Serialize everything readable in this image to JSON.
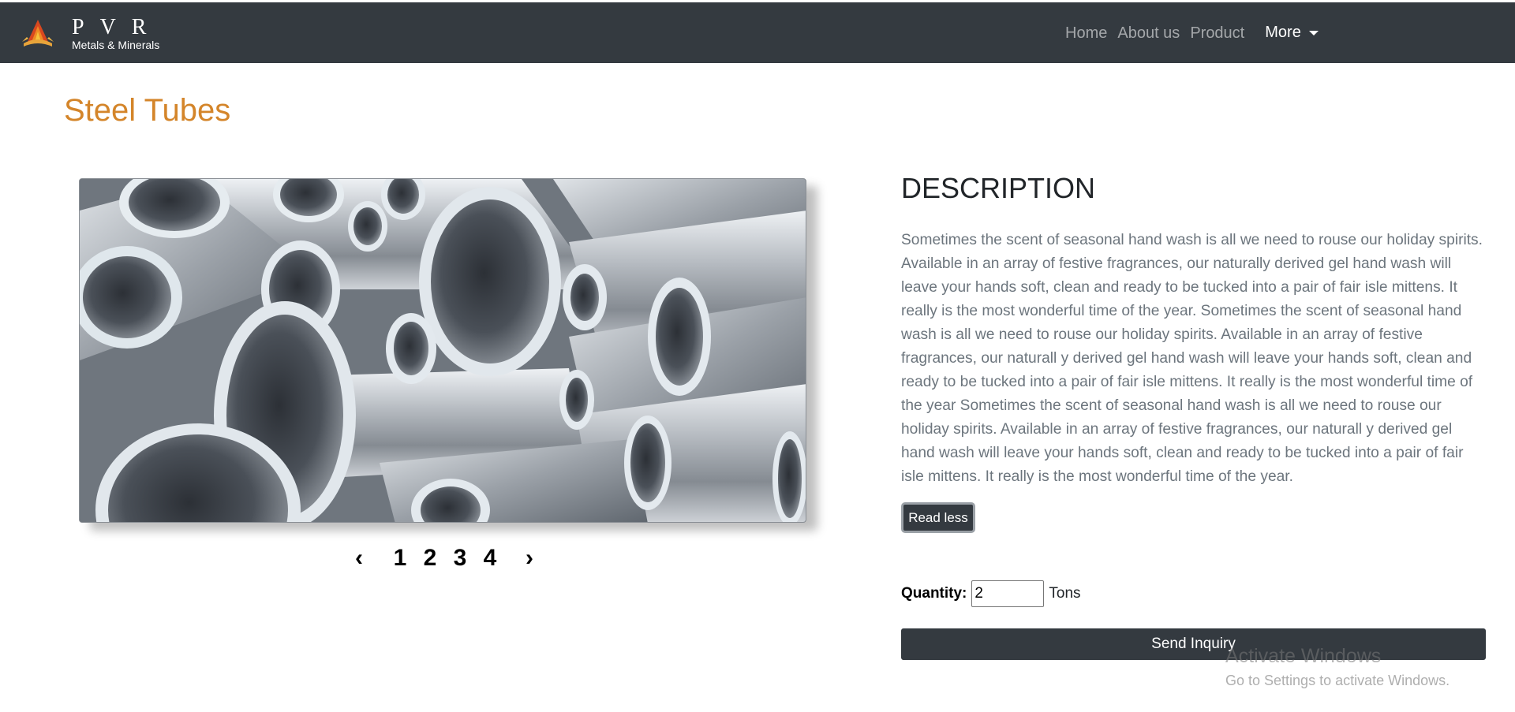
{
  "navbar": {
    "brand_title": "PVR",
    "brand_subtitle": "Metals & Minerals",
    "links": [
      "Home",
      "About us",
      "Product"
    ],
    "more_label": "More"
  },
  "page": {
    "title": "Steel Tubes"
  },
  "gallery": {
    "prev_symbol": "‹",
    "next_symbol": "›",
    "pages": [
      "1",
      "2",
      "3",
      "4"
    ]
  },
  "description": {
    "heading": "DESCRIPTION",
    "text": "Sometimes the scent of seasonal hand wash is all we need to rouse our holiday spirits. Available in an array of festive fragrances, our naturally derived gel hand wash will leave your hands soft, clean and ready to be tucked into a pair of fair isle mittens. It really is the most wonderful time of the year. Sometimes the scent of seasonal hand wash is all we need to rouse our holiday spirits. Available in an array of festive fragrances, our naturall y derived gel hand wash will leave your hands soft, clean and ready to be tucked into a pair of fair isle mittens. It really is the most wonderful time of the year Sometimes the scent of seasonal hand wash is all we need to rouse our holiday spirits. Available in an array of festive fragrances, our naturall y derived gel hand wash will leave your hands soft, clean and ready to be tucked into a pair of fair isle mittens. It really is the most wonderful time of the year.",
    "toggle_label": "Read less"
  },
  "inquiry": {
    "quantity_label": "Quantity:",
    "quantity_value": "2",
    "unit": "Tons",
    "button_label": "Send Inquiry"
  },
  "watermark": {
    "title": "Activate Windows",
    "subtitle": "Go to Settings to activate Windows."
  },
  "colors": {
    "navbar_bg": "#343a40",
    "title_accent": "#d4852a",
    "body_text": "#6c757d",
    "button_dark": "#343a40"
  },
  "icons": {
    "brand_logo": "flame-logo-icon",
    "dropdown": "caret-down-icon"
  }
}
